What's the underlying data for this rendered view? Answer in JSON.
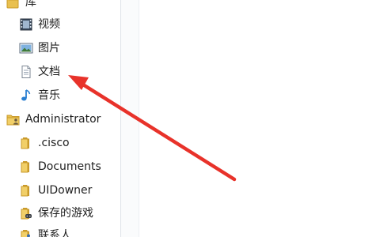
{
  "nav": {
    "library": {
      "label": "库",
      "icon": "library-icon"
    },
    "library_items": [
      {
        "label": "视频",
        "icon": "video-library-icon"
      },
      {
        "label": "图片",
        "icon": "picture-library-icon"
      },
      {
        "label": "文档",
        "icon": "document-library-icon"
      },
      {
        "label": "音乐",
        "icon": "music-library-icon"
      }
    ],
    "user": {
      "label": "Administrator",
      "icon": "user-folder-icon"
    },
    "user_items": [
      {
        "label": ".cisco",
        "icon": "folder-icon"
      },
      {
        "label": "Documents",
        "icon": "folder-icon"
      },
      {
        "label": "UIDowner",
        "icon": "folder-icon"
      },
      {
        "label": "保存的游戏",
        "icon": "saved-games-icon"
      },
      {
        "label": "联系人",
        "icon": "contacts-icon"
      }
    ]
  },
  "annotation": {
    "arrow_color": "#e8322a"
  },
  "colors": {
    "folder": "#e9c04f",
    "folder_dark": "#c99a2a",
    "music": "#2a7fd1"
  }
}
